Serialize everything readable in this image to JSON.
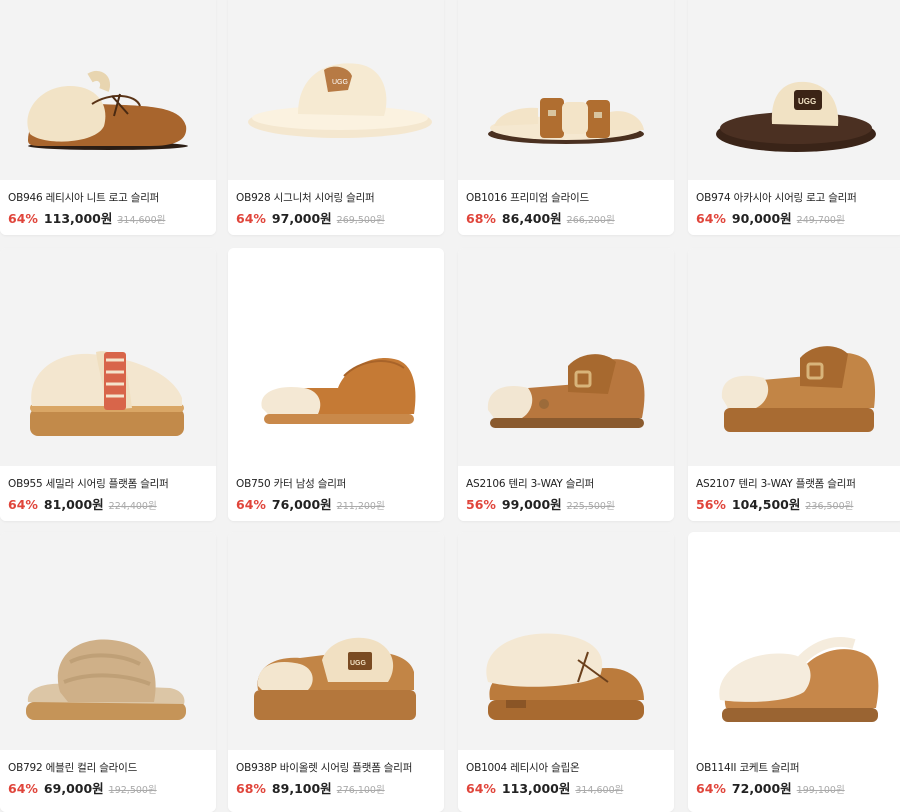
{
  "colors": {
    "discount": "#e0453b",
    "text": "#222222",
    "muted": "#aaaaaa",
    "background": "#f3f3f3"
  },
  "products": [
    {
      "name": "OB946 레티시아 니트 로고 슬리퍼",
      "discount": "64%",
      "price": "113,000원",
      "original": "314,600원",
      "icon": "slipper-loafer-chestnut-icon"
    },
    {
      "name": "OB928 시그니처 시어링 슬리퍼",
      "discount": "64%",
      "price": "97,000원",
      "original": "269,500원",
      "icon": "slide-fluffy-cream-icon"
    },
    {
      "name": "OB1016 프리미엄 슬라이드",
      "discount": "68%",
      "price": "86,400원",
      "original": "266,200원",
      "icon": "slide-buckle-cream-icon"
    },
    {
      "name": "OB974 아카시아 시어링 로고 슬리퍼",
      "discount": "64%",
      "price": "90,000원",
      "original": "249,700원",
      "icon": "slide-dark-shearling-icon"
    },
    {
      "name": "OB955 세밀라 시어링 플랫폼 슬리퍼",
      "discount": "64%",
      "price": "81,000원",
      "original": "224,400원",
      "icon": "platform-strap-slipper-icon"
    },
    {
      "name": "OB750 카터 남성 슬리퍼",
      "discount": "64%",
      "price": "76,000원",
      "original": "211,200원",
      "icon": "scuff-slipper-chestnut-icon"
    },
    {
      "name": "AS2106 텐리 3-WAY 슬리퍼",
      "discount": "56%",
      "price": "99,000원",
      "original": "225,500원",
      "icon": "clog-buckle-chestnut-icon"
    },
    {
      "name": "AS2107 텐리 3-WAY 플랫폼 슬리퍼",
      "discount": "56%",
      "price": "104,500원",
      "original": "236,500원",
      "icon": "platform-clog-buckle-icon"
    },
    {
      "name": "OB792 에블린 컬리 슬라이드",
      "discount": "64%",
      "price": "69,000원",
      "original": "192,500원",
      "icon": "slide-curly-sand-icon"
    },
    {
      "name": "OB938P 바이올렛 시어링 플랫폼 슬리퍼",
      "discount": "68%",
      "price": "89,100원",
      "original": "276,100원",
      "icon": "platform-slipper-logo-icon"
    },
    {
      "name": "OB1004 레티시아 슬립온",
      "discount": "64%",
      "price": "113,000원",
      "original": "314,600원",
      "icon": "slipon-moccasin-icon"
    },
    {
      "name": "OB114II 코케트 슬리퍼",
      "discount": "64%",
      "price": "72,000원",
      "original": "199,100원",
      "icon": "coquette-slipper-icon"
    }
  ]
}
